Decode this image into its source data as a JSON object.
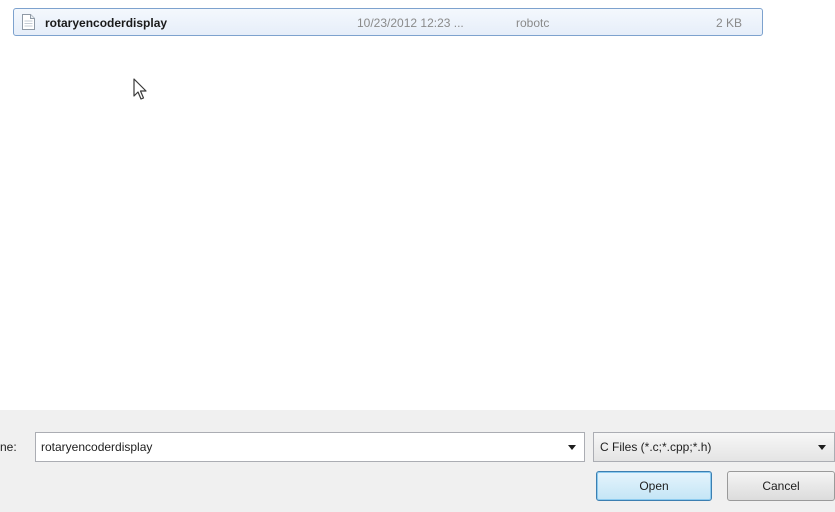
{
  "file_list": {
    "files": [
      {
        "name": "rotaryencoderdisplay",
        "date_modified": "10/23/2012 12:23 ...",
        "type": "robotc",
        "size": "2 KB",
        "selected": true
      }
    ]
  },
  "file_name": {
    "label": "ne:",
    "value": "rotaryencoderdisplay"
  },
  "file_type_filter": {
    "selected": "C Files (*.c;*.cpp;*.h)"
  },
  "buttons": {
    "open_label": "Open",
    "cancel_label": "Cancel"
  },
  "colors": {
    "selection_border": "#7da2ce",
    "panel_background": "#f0f0f0",
    "open_button_border": "#3c7fb1"
  }
}
